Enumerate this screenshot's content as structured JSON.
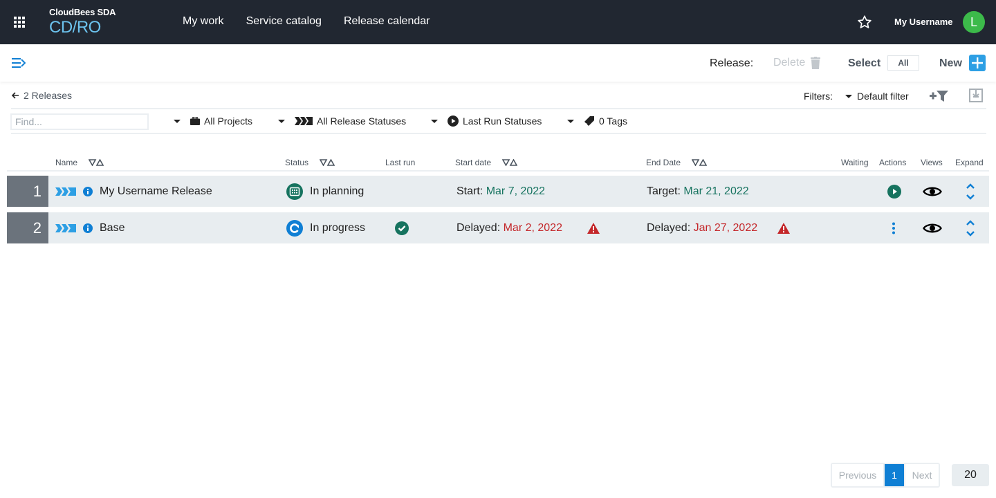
{
  "topbar": {
    "brand_top": "CloudBees SDA",
    "brand_main": "CD/RO",
    "nav": [
      "My work",
      "Service catalog",
      "Release calendar"
    ],
    "username": "My Username",
    "avatar_initial": "L",
    "avatar_color": "#3cba4a"
  },
  "toolbar": {
    "release_label": "Release:",
    "delete_label": "Delete",
    "select_label": "Select",
    "all_label": "All",
    "new_label": "New"
  },
  "subheader": {
    "back_label": "2 Releases",
    "filters_label": "Filters:",
    "default_filter": "Default filter"
  },
  "filters": {
    "find_placeholder": "Find...",
    "find_value": "",
    "projects": "All Projects",
    "release_statuses": "All Release Statuses",
    "last_run_statuses": "Last Run Statuses",
    "tags": "0 Tags"
  },
  "table": {
    "columns": {
      "name": "Name",
      "status": "Status",
      "last_run": "Last run",
      "start_date": "Start date",
      "end_date": "End Date",
      "waiting": "Waiting",
      "actions": "Actions",
      "views": "Views",
      "expand": "Expand"
    },
    "rows": [
      {
        "num": "1",
        "name": "My Username Release",
        "status": "In planning",
        "status_icon": "calendar-icon",
        "last_run_icon": "",
        "start_prefix": "Start: ",
        "start_date": "Mar 7, 2022",
        "start_warning": false,
        "end_prefix": "Target: ",
        "end_date": "Mar 21, 2022",
        "end_warning": false,
        "action_icon": "play-icon"
      },
      {
        "num": "2",
        "name": "Base",
        "status": "In progress",
        "status_icon": "refresh-icon",
        "last_run_icon": "check-circle-icon",
        "start_prefix": "Delayed: ",
        "start_date": "Mar 2, 2022",
        "start_warning": true,
        "end_prefix": "Delayed: ",
        "end_date": "Jan 27, 2022",
        "end_warning": true,
        "action_icon": "more-vertical-icon"
      }
    ]
  },
  "pagination": {
    "previous": "Previous",
    "current": "1",
    "next": "Next",
    "page_size": "20"
  },
  "colors": {
    "topbar_bg": "#212731",
    "accent_blue": "#0f7fd4",
    "ok_green": "#16735f",
    "danger_red": "#c4272a"
  }
}
